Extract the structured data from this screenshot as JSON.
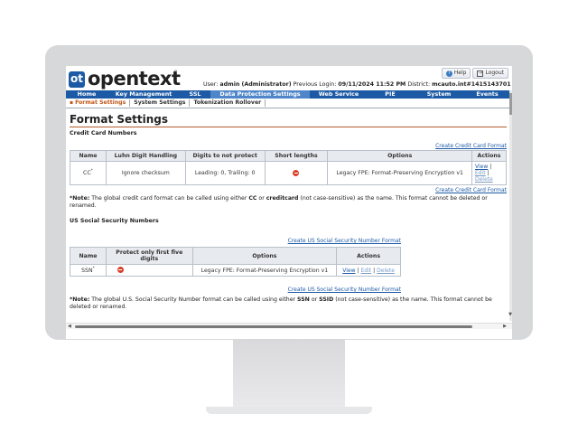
{
  "header": {
    "logo_mark": "ot",
    "logo_text": "opentext",
    "logo_tm": "™",
    "help_label": "Help",
    "logout_label": "Logout",
    "user_prefix": "User:",
    "user_value": "admin (Administrator)",
    "login_prefix": "Previous Login:",
    "login_value": "09/11/2024 11:52 PM",
    "district_prefix": "District:",
    "district_value": "mcauto.int#1415143701"
  },
  "nav": {
    "items": [
      "Home",
      "Key Management",
      "SSL",
      "Data Protection Settings",
      "Web Service",
      "PIE",
      "System",
      "Events"
    ],
    "active_index": 3
  },
  "subnav": {
    "items": [
      "Format Settings",
      "System Settings",
      "Tokenization Rollover"
    ],
    "active_index": 0
  },
  "page": {
    "title": "Format Settings",
    "credit_card": {
      "section_title": "Credit Card Numbers",
      "create_link": "Create Credit Card Format",
      "headers": [
        "Name",
        "Luhn Digit Handling",
        "Digits to not protect",
        "Short lengths",
        "Options",
        "Actions"
      ],
      "row": {
        "name": "CC",
        "name_sup": "*",
        "luhn": "Ignore checksum",
        "digits": "Leading: 0, Trailing: 0",
        "options": "Legacy FPE: Format-Preserving Encryption v1",
        "actions": [
          "View",
          "Edit",
          "Delete"
        ]
      },
      "note_label": "*Note:",
      "note_text_1": "The global credit card format can be called using either",
      "note_cc": "CC",
      "note_or": "or",
      "note_cc2": "creditcard",
      "note_text_2": "(not case-sensitive) as the name. This format cannot be deleted or renamed."
    },
    "ssn": {
      "section_title": "US Social Security Numbers",
      "create_link": "Create US Social Security Number Format",
      "headers": [
        "Name",
        "Protect only first five digits",
        "Options",
        "Actions"
      ],
      "row": {
        "name": "SSN",
        "name_sup": "*",
        "options": "Legacy FPE: Format-Preserving Encryption v1",
        "actions": [
          "View",
          "Edit",
          "Delete"
        ]
      },
      "note_label": "*Note:",
      "note_text_1": "The global U.S. Social Security Number format can be called using either",
      "note_ssn": "SSN",
      "note_or": "or",
      "note_ssid": "SSID",
      "note_text_2": "(not case-sensitive) as the name. This format cannot be deleted or renamed."
    }
  },
  "colors": {
    "nav_blue": "#1c5aa6",
    "nav_active": "#4f86c9",
    "title_rule": "#b55a2a",
    "subnav_active": "#c0581a",
    "block_icon": "#d9402b"
  }
}
